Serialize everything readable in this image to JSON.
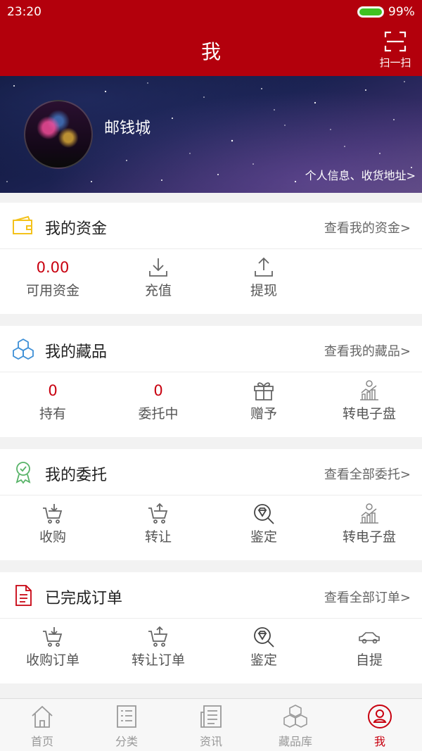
{
  "status_bar": {
    "time": "23:20",
    "battery_level": 0.99,
    "battery_text": "99%"
  },
  "nav": {
    "title": "我",
    "scan_label": "扫一扫"
  },
  "profile": {
    "username": "邮钱城",
    "info_link": "个人信息、收货地址>"
  },
  "funds": {
    "title": "我的资金",
    "link": "查看我的资金>",
    "items": [
      {
        "value": "0.00",
        "label": "可用资金"
      },
      {
        "icon": "download-icon",
        "label": "充值"
      },
      {
        "icon": "upload-icon",
        "label": "提现"
      }
    ]
  },
  "collection": {
    "title": "我的藏品",
    "link": "查看我的藏品>",
    "items": [
      {
        "value": "0",
        "label": "持有"
      },
      {
        "value": "0",
        "label": "委托中"
      },
      {
        "icon": "gift-icon",
        "label": "赠予"
      },
      {
        "icon": "chart-icon",
        "label": "转电子盘"
      }
    ]
  },
  "entrust": {
    "title": "我的委托",
    "link": "查看全部委托>",
    "items": [
      {
        "icon": "cart-in-icon",
        "label": "收购"
      },
      {
        "icon": "cart-out-icon",
        "label": "转让"
      },
      {
        "icon": "diamond-search-icon",
        "label": "鉴定"
      },
      {
        "icon": "chart-icon",
        "label": "转电子盘"
      }
    ]
  },
  "orders": {
    "title": "已完成订单",
    "link": "查看全部订单>",
    "items": [
      {
        "icon": "cart-in-icon",
        "label": "收购订单"
      },
      {
        "icon": "cart-out-icon",
        "label": "转让订单"
      },
      {
        "icon": "diamond-search-icon",
        "label": "鉴定"
      },
      {
        "icon": "car-icon",
        "label": "自提"
      }
    ]
  },
  "tabs": [
    {
      "label": "首页",
      "icon": "home-icon"
    },
    {
      "label": "分类",
      "icon": "list-icon"
    },
    {
      "label": "资讯",
      "icon": "news-icon"
    },
    {
      "label": "藏品库",
      "icon": "boxes-icon"
    },
    {
      "label": "我",
      "icon": "user-icon",
      "active": true
    }
  ],
  "colors": {
    "brand_red": "#b3000c",
    "value_red": "#c8000f",
    "wallet_yellow": "#f4c21b",
    "cube_blue": "#3d8fd6",
    "badge_green": "#58b368"
  }
}
